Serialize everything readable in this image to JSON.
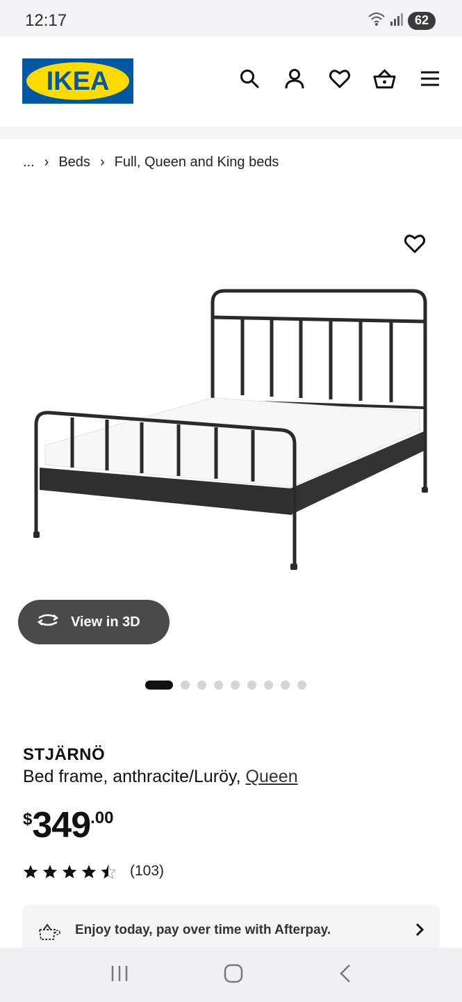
{
  "status_bar": {
    "time": "12:17",
    "battery": "62"
  },
  "header": {
    "logo_text": "IKEA",
    "icons": [
      "search-icon",
      "account-icon",
      "heart-icon",
      "basket-icon",
      "menu-icon"
    ]
  },
  "breadcrumb": {
    "ellipsis": "...",
    "items": [
      "Beds",
      "Full, Queen and King beds"
    ]
  },
  "product": {
    "view3d_label": "View in 3D",
    "gallery": {
      "count": 9,
      "active_index": 0
    },
    "name": "STJÄRNÖ",
    "description": "Bed frame, anthracite/Luröy, ",
    "size_link": "Queen",
    "price": {
      "currency": "$",
      "integer": "349",
      "decimal": ".00"
    },
    "rating": {
      "stars": 4.5,
      "count": "(103)"
    }
  },
  "afterpay": {
    "text": "Enjoy today, pay over time with Afterpay."
  },
  "colors": {
    "brand_blue": "#0058a3",
    "brand_yellow": "#ffdb00"
  }
}
